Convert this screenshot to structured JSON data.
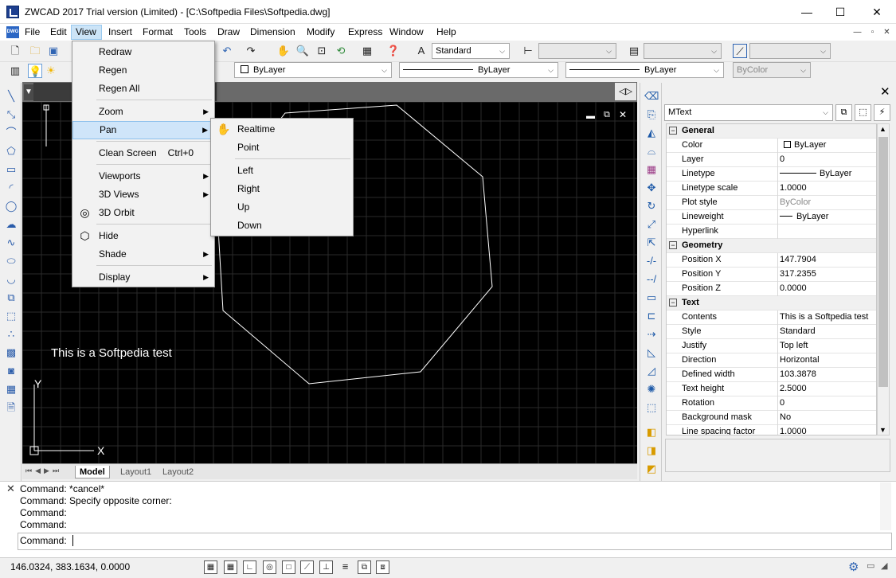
{
  "titlebar": {
    "title": "ZWCAD 2017 Trial version (Limited) - [C:\\Softpedia Files\\Softpedia.dwg]",
    "minimize": "—",
    "maximize": "☐",
    "close": "✕"
  },
  "menubar": {
    "doc_icon": "DWG",
    "items": [
      "File",
      "Edit",
      "View",
      "Insert",
      "Format",
      "Tools",
      "Draw",
      "Dimension",
      "Modify",
      "Express",
      "Window",
      "Help"
    ],
    "active": "View",
    "mdi_controls": [
      "—",
      "▫",
      "✕"
    ]
  },
  "toolbar": {
    "text_style": "Standard",
    "dim_style": "",
    "table_style": "",
    "multileader_style": "",
    "color": "ByLayer",
    "linetype": "ByLayer",
    "lineweight": "ByLayer",
    "plot_style": "ByColor"
  },
  "view_menu": {
    "items": [
      {
        "label": "Redraw"
      },
      {
        "label": "Regen"
      },
      {
        "label": "Regen All"
      },
      {
        "label": "Zoom",
        "submenu": true
      },
      {
        "label": "Pan",
        "submenu": true,
        "highlighted": true
      },
      {
        "label": "Clean Screen",
        "shortcut": "Ctrl+0"
      },
      {
        "label": "Viewports",
        "submenu": true
      },
      {
        "label": "3D Views",
        "submenu": true
      },
      {
        "label": "3D Orbit",
        "icon": "orbit-icon"
      },
      {
        "label": "Hide",
        "icon": "hide-icon"
      },
      {
        "label": "Shade",
        "submenu": true
      },
      {
        "label": "Display",
        "submenu": true
      }
    ]
  },
  "pan_menu": {
    "items": [
      {
        "label": "Realtime",
        "icon": "hand-icon"
      },
      {
        "label": "Point"
      },
      {
        "label": "Left"
      },
      {
        "label": "Right"
      },
      {
        "label": "Up"
      },
      {
        "label": "Down"
      }
    ]
  },
  "canvas": {
    "text": "This is a Softpedia test",
    "axis_x": "X",
    "axis_y": "Y",
    "background": "#000000",
    "grid_color": "#2a2a2a",
    "line_color": "#ffffff"
  },
  "layout_tabs": [
    "Model",
    "Layout1",
    "Layout2"
  ],
  "properties": {
    "object_type": "MText",
    "groups": [
      {
        "name": "General",
        "rows": [
          {
            "key": "Color",
            "value": "ByLayer",
            "swatch": "box"
          },
          {
            "key": "Layer",
            "value": "0"
          },
          {
            "key": "Linetype",
            "value": "ByLayer",
            "swatch": "line"
          },
          {
            "key": "Linetype scale",
            "value": "1.0000"
          },
          {
            "key": "Plot style",
            "value": "ByColor",
            "grey": true
          },
          {
            "key": "Lineweight",
            "value": "ByLayer",
            "swatch": "short"
          },
          {
            "key": "Hyperlink",
            "value": ""
          }
        ]
      },
      {
        "name": "Geometry",
        "rows": [
          {
            "key": "Position X",
            "value": "147.7904"
          },
          {
            "key": "Position Y",
            "value": "317.2355"
          },
          {
            "key": "Position Z",
            "value": "0.0000"
          }
        ]
      },
      {
        "name": "Text",
        "rows": [
          {
            "key": "Contents",
            "value": "This is a Softpedia test"
          },
          {
            "key": "Style",
            "value": "Standard"
          },
          {
            "key": "Justify",
            "value": "Top left"
          },
          {
            "key": "Direction",
            "value": "Horizontal"
          },
          {
            "key": "Defined width",
            "value": "103.3878"
          },
          {
            "key": "Text height",
            "value": "2.5000"
          },
          {
            "key": "Rotation",
            "value": "0"
          },
          {
            "key": "Background mask",
            "value": "No"
          },
          {
            "key": "Line spacing factor",
            "value": "1.0000"
          }
        ]
      }
    ]
  },
  "command": {
    "history": [
      "Command: *cancel*",
      "Command: Specify opposite corner:",
      "Command:",
      "Command:"
    ],
    "prompt": "Command:",
    "close": "✕"
  },
  "status": {
    "coords": "146.0324, 383.1634, 0.0000"
  }
}
